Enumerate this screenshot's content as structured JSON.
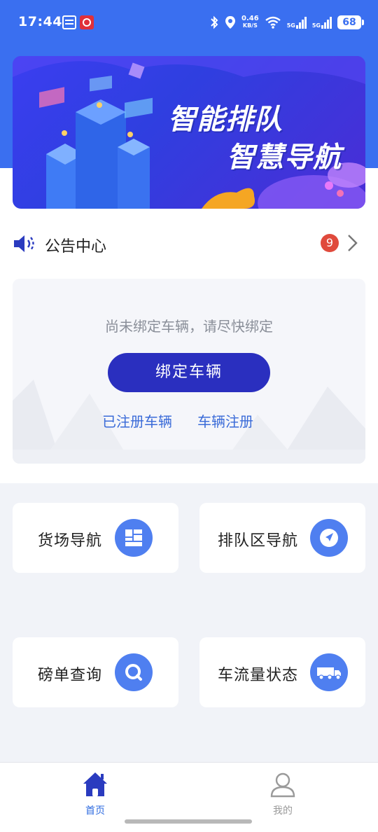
{
  "status_bar": {
    "time": "17:44",
    "net_speed_value": "0.46",
    "net_speed_unit": "KB/S",
    "sim1_label": "5G",
    "sim2_label": "5G",
    "battery": "68"
  },
  "banner": {
    "line1": "智能排队",
    "line2": "智慧导航"
  },
  "notice": {
    "title": "公告中心",
    "badge_count": "9"
  },
  "bind_card": {
    "hint": "尚未绑定车辆，请尽快绑定",
    "bind_button": "绑定车辆",
    "registered_link": "已注册车辆",
    "register_link": "车辆注册"
  },
  "functions": {
    "yard_nav": {
      "label": "货场导航",
      "icon": "map-icon"
    },
    "queue_nav": {
      "label": "排队区导航",
      "icon": "navigation-icon"
    },
    "weigh_query": {
      "label": "磅单查询",
      "icon": "search-icon"
    },
    "traffic_status": {
      "label": "车流量状态",
      "icon": "truck-icon"
    }
  },
  "bottom_nav": {
    "home_label": "首页",
    "me_label": "我的"
  },
  "colors": {
    "primary": "#3a6ff0",
    "button": "#2a2fbf",
    "link": "#3a6bd8",
    "badge": "#e04a3c"
  }
}
